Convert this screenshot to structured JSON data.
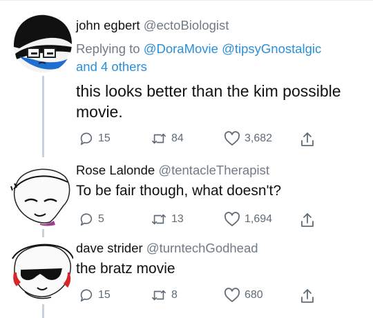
{
  "tweets": [
    {
      "name": "john egbert",
      "handle": "@ectoBiologist",
      "replying_prefix": "Replying to",
      "replying_mentions": "@DoraMovie @tipsyGnostalgic",
      "replying_others": "and 4 others",
      "text": "this looks better than the kim possible movie.",
      "replies": "15",
      "retweets": "84",
      "likes": "3,682"
    },
    {
      "name": "Rose Lalonde",
      "handle": "@tentacleTherapist",
      "text": "To be fair though, what doesn't?",
      "replies": "5",
      "retweets": "13",
      "likes": "1,694"
    },
    {
      "name": "dave strider",
      "handle": "@turntechGodhead",
      "text": "the bratz movie",
      "replies": "15",
      "retweets": "8",
      "likes": "680"
    }
  ],
  "icons": [
    "reply-icon",
    "retweet-icon",
    "like-icon",
    "share-icon"
  ],
  "colors": {
    "link": "#2a8fd8",
    "muted": "#6f7b86",
    "thread_line": "#c9d2db"
  }
}
